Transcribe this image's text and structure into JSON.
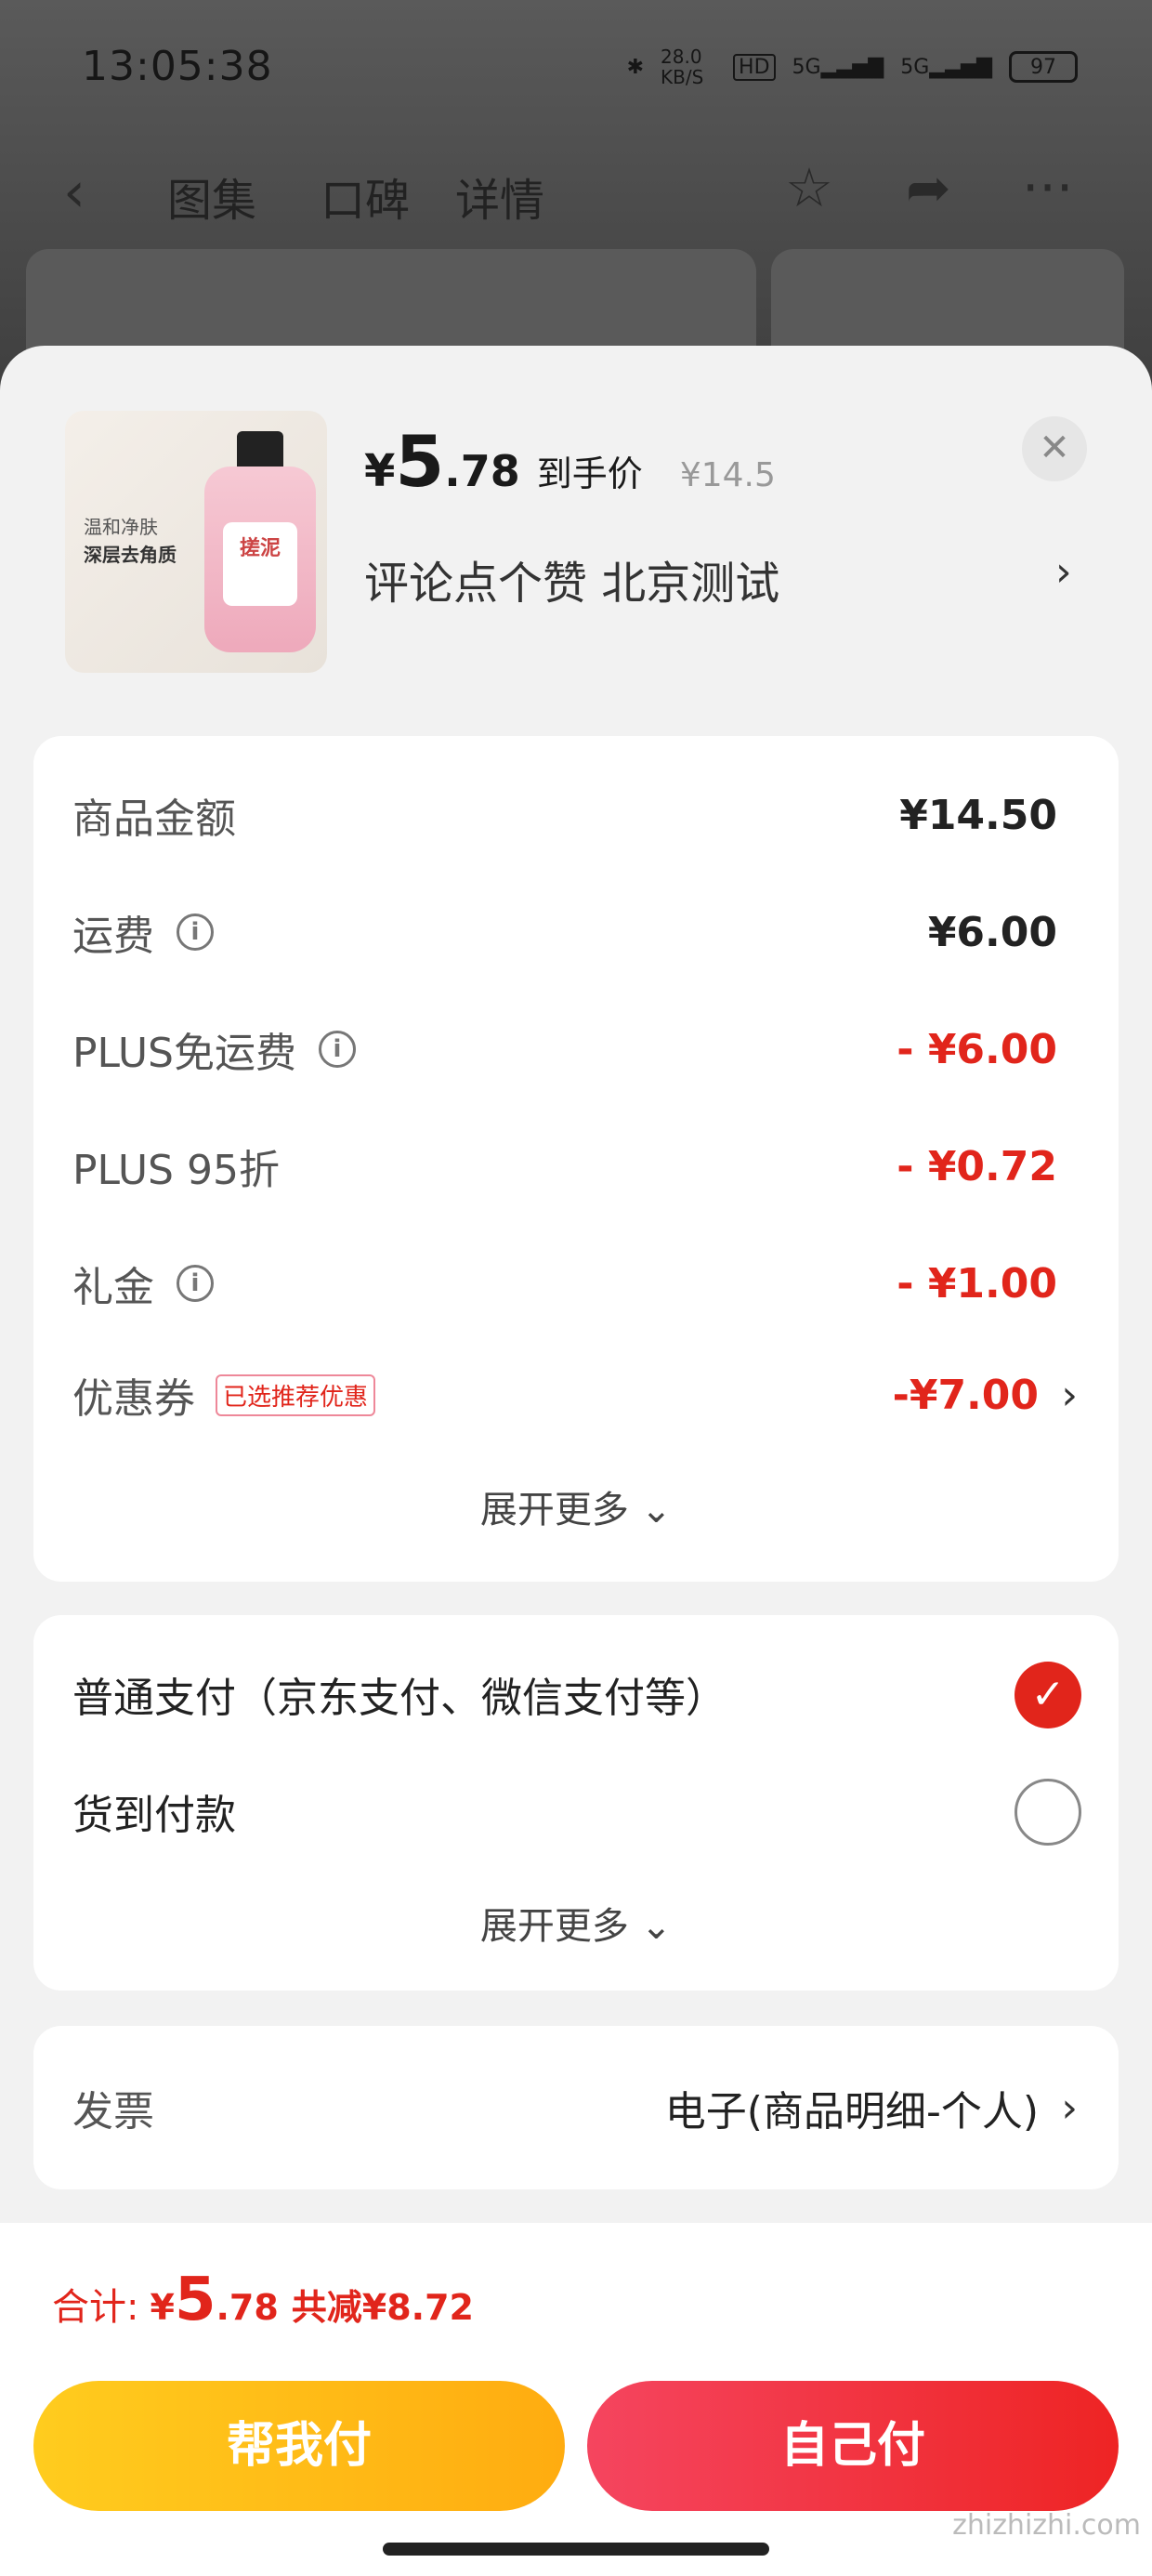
{
  "status_bar": {
    "time": "13:05:38",
    "net_speed": "28.0 KB/S",
    "hd": "HD",
    "sig1": "5G",
    "sig2": "5G",
    "battery": "97"
  },
  "nav": {
    "tabs": [
      "图集",
      "口碑",
      "详情"
    ]
  },
  "product_card": {
    "thumb_texts": [
      "温和净肤",
      "深层去角质",
      "搓泥"
    ],
    "price_yen": "¥",
    "price_int": "5",
    "price_dec": ".78",
    "price_tag": "到手价",
    "original_price": "¥14.5",
    "subtitle": "评论点个赞  北京测试"
  },
  "fees": [
    {
      "label": "商品金额",
      "value": "¥14.50"
    },
    {
      "label": "运费",
      "value": "¥6.00"
    },
    {
      "label": "PLUS免运费",
      "value": "- ¥6.00"
    },
    {
      "label": "PLUS 95折",
      "value": "- ¥0.72"
    },
    {
      "label": "礼金",
      "value": "- ¥1.00"
    },
    {
      "label": "优惠券",
      "badge": "已选推荐优惠",
      "value": "-¥7.00"
    }
  ],
  "expand_more": "展开更多",
  "payment": {
    "option1": "普通支付（京东支付、微信支付等）",
    "option2": "货到付款"
  },
  "invoice": {
    "label": "发票",
    "value": "电子(商品明细-个人)"
  },
  "footer": {
    "total_label": "合计:",
    "total_yen": "¥",
    "total_int": "5",
    "total_dec": ".78",
    "saved": "共减¥8.72",
    "btn_help": "帮我付",
    "btn_self": "自己付"
  },
  "watermark": "zhizhizhi.com",
  "colors": {
    "accent_red": "#e1251b",
    "yellow": "#ffb816"
  }
}
